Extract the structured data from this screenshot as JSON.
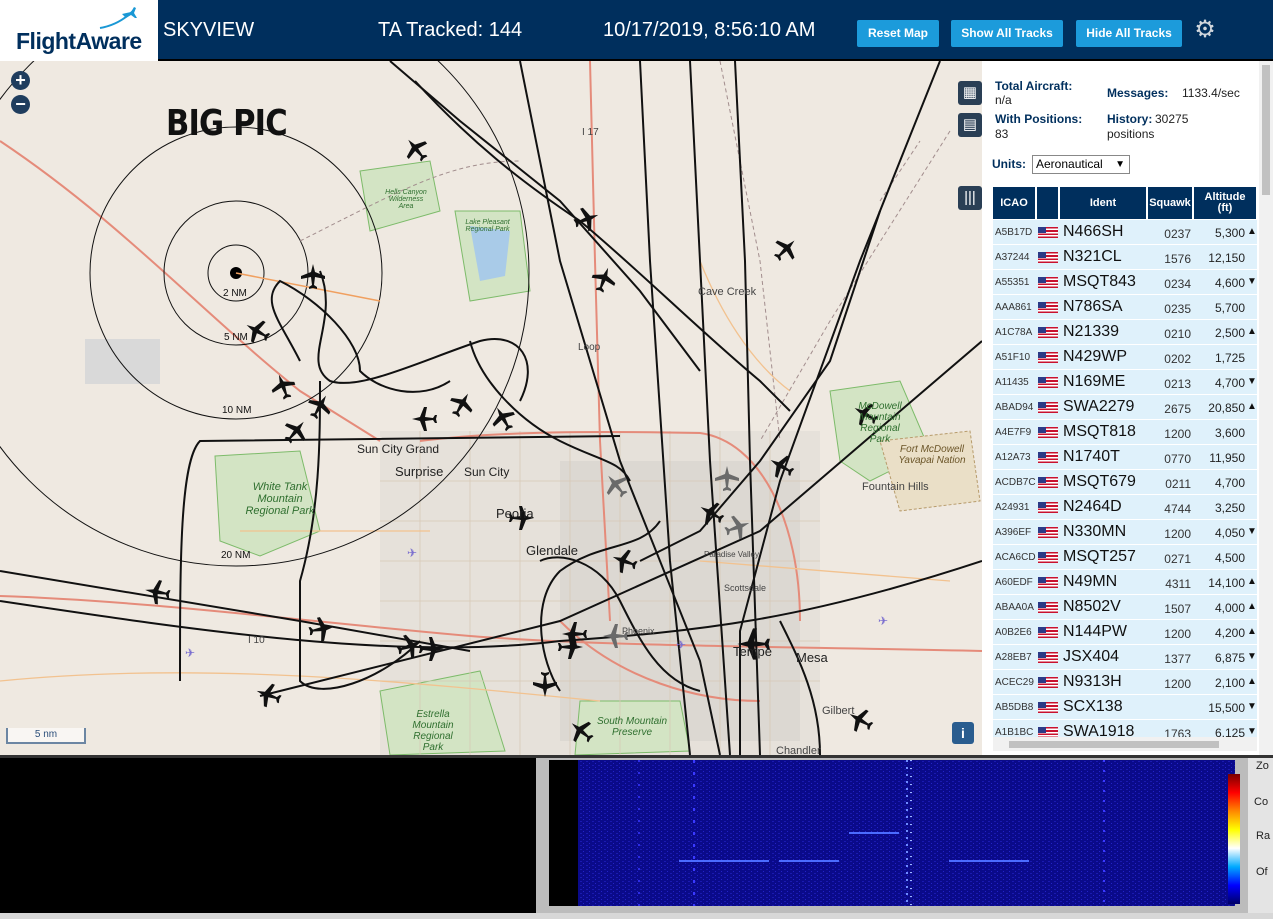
{
  "header": {
    "logo_main": "Flight",
    "logo_accent": "Aware",
    "app_title": "SKYVIEW",
    "tracked": "TA Tracked: 144",
    "datetime": "10/17/2019, 8:56:10 AM",
    "reset_map": "Reset Map",
    "show_all": "Show All Tracks",
    "hide_all": "Hide All Tracks"
  },
  "map": {
    "overlay_title": "BIG PIC",
    "scale": "5 nm",
    "rings": [
      "2 NM",
      "5 NM",
      "10 NM",
      "20 NM"
    ],
    "places": [
      {
        "name": "Sun City Grand",
        "cls": "city"
      },
      {
        "name": "Surprise",
        "cls": "city big"
      },
      {
        "name": "Sun City",
        "cls": "city"
      },
      {
        "name": "Peoria",
        "cls": "city big"
      },
      {
        "name": "Glendale",
        "cls": "city big"
      },
      {
        "name": "Cave Creek",
        "cls": ""
      },
      {
        "name": "Fountain Hills",
        "cls": ""
      },
      {
        "name": "Scottsdale",
        "cls": ""
      },
      {
        "name": "Tempe",
        "cls": "city big"
      },
      {
        "name": "Mesa",
        "cls": "city big"
      },
      {
        "name": "Gilbert",
        "cls": ""
      },
      {
        "name": "Chandler",
        "cls": ""
      },
      {
        "name": "Phoenix",
        "cls": ""
      },
      {
        "name": "Paradise Valley",
        "cls": ""
      },
      {
        "name": "Loop",
        "cls": ""
      },
      {
        "name": "I 17",
        "cls": ""
      },
      {
        "name": "I 10",
        "cls": ""
      }
    ],
    "parks": [
      "White Tank Mountain Regional Park",
      "Estrella Mountain Regional Park",
      "South Mountain Preserve",
      "McDowell Mountain Regional Park",
      "Fort McDowell Yavapai Nation",
      "Lake Pleasant Regional Park",
      "Hells Canyon Wilderness Area"
    ]
  },
  "sidebar": {
    "total_aircraft_label": "Total Aircraft:",
    "total_aircraft_value": "n/a",
    "messages_label": "Messages:",
    "messages_value": "1133.4/sec",
    "with_positions_label": "With Positions:",
    "with_positions_value": "83",
    "history_label": "History:",
    "history_value": "30275 positions",
    "units_label": "Units:",
    "units_value": "Aeronautical",
    "columns": [
      "ICAO",
      "",
      "Ident",
      "Squawk",
      "Altitude (ft)"
    ],
    "rows": [
      {
        "icao": "A5B17D",
        "ident": "N466SH",
        "squawk": "0237",
        "alt": "5,300",
        "dir": "▲"
      },
      {
        "icao": "A37244",
        "ident": "N321CL",
        "squawk": "1576",
        "alt": "12,150",
        "dir": ""
      },
      {
        "icao": "A55351",
        "ident": "MSQT843",
        "squawk": "0234",
        "alt": "4,600",
        "dir": "▼"
      },
      {
        "icao": "AAA861",
        "ident": "N786SA",
        "squawk": "0235",
        "alt": "5,700",
        "dir": ""
      },
      {
        "icao": "A1C78A",
        "ident": "N21339",
        "squawk": "0210",
        "alt": "2,500",
        "dir": "▲"
      },
      {
        "icao": "A51F10",
        "ident": "N429WP",
        "squawk": "0202",
        "alt": "1,725",
        "dir": ""
      },
      {
        "icao": "A11435",
        "ident": "N169ME",
        "squawk": "0213",
        "alt": "4,700",
        "dir": "▼"
      },
      {
        "icao": "ABAD94",
        "ident": "SWA2279",
        "squawk": "2675",
        "alt": "20,850",
        "dir": "▲"
      },
      {
        "icao": "A4E7F9",
        "ident": "MSQT818",
        "squawk": "1200",
        "alt": "3,600",
        "dir": ""
      },
      {
        "icao": "A12A73",
        "ident": "N1740T",
        "squawk": "0770",
        "alt": "11,950",
        "dir": ""
      },
      {
        "icao": "ACDB7C",
        "ident": "MSQT679",
        "squawk": "0211",
        "alt": "4,700",
        "dir": ""
      },
      {
        "icao": "A24931",
        "ident": "N2464D",
        "squawk": "4744",
        "alt": "3,250",
        "dir": ""
      },
      {
        "icao": "A396EF",
        "ident": "N330MN",
        "squawk": "1200",
        "alt": "4,050",
        "dir": "▼"
      },
      {
        "icao": "ACA6CD",
        "ident": "MSQT257",
        "squawk": "0271",
        "alt": "4,500",
        "dir": ""
      },
      {
        "icao": "A60EDF",
        "ident": "N49MN",
        "squawk": "4311",
        "alt": "14,100",
        "dir": "▲"
      },
      {
        "icao": "ABAA0A",
        "ident": "N8502V",
        "squawk": "1507",
        "alt": "4,000",
        "dir": "▲"
      },
      {
        "icao": "A0B2E6",
        "ident": "N144PW",
        "squawk": "1200",
        "alt": "4,200",
        "dir": "▲"
      },
      {
        "icao": "A28EB7",
        "ident": "JSX404",
        "squawk": "1377",
        "alt": "6,875",
        "dir": "▼"
      },
      {
        "icao": "ACEC29",
        "ident": "N9313H",
        "squawk": "1200",
        "alt": "2,100",
        "dir": "▲"
      },
      {
        "icao": "AB5DB8",
        "ident": "SCX138",
        "squawk": "",
        "alt": "15,500",
        "dir": "▼"
      },
      {
        "icao": "A1B1BC",
        "ident": "SWA1918",
        "squawk": "1763",
        "alt": "6,125",
        "dir": "▼"
      }
    ]
  },
  "bottom": {
    "controls": [
      "Zo",
      "Co",
      "Ra",
      "Of"
    ]
  }
}
